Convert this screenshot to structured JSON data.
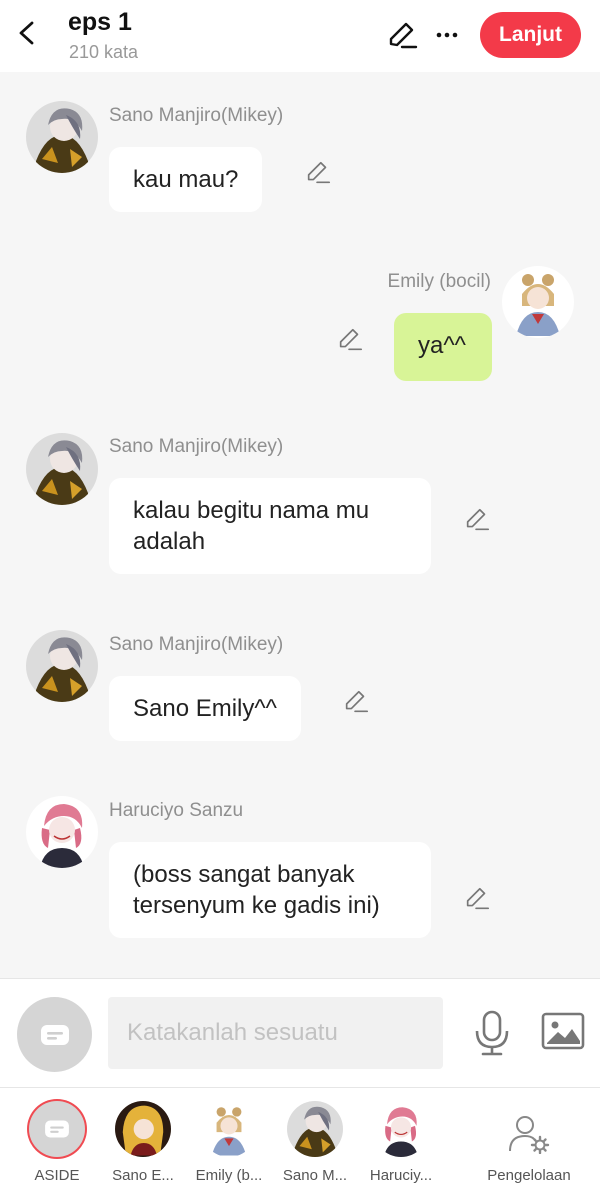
{
  "header": {
    "title": "eps 1",
    "word_count": "210 kata",
    "next_label": "Lanjut",
    "accent_color": "#f33a49"
  },
  "messages": [
    {
      "sender": "Sano Manjiro(Mikey)",
      "text": "kau mau?",
      "side": "left"
    },
    {
      "sender": "Emily (bocil)",
      "text": "ya^^",
      "side": "right"
    },
    {
      "sender": "Sano Manjiro(Mikey)",
      "text": "kalau begitu nama mu adalah",
      "side": "left"
    },
    {
      "sender": "Sano Manjiro(Mikey)",
      "text": "Sano Emily^^",
      "side": "left"
    },
    {
      "sender": "Haruciyo Sanzu",
      "text": "(boss sangat banyak tersenyum ke gadis ini)",
      "side": "left"
    }
  ],
  "composer": {
    "placeholder": "Katakanlah sesuatu",
    "value": ""
  },
  "bottom_tabs": [
    {
      "label": "ASIDE"
    },
    {
      "label": "Sano E..."
    },
    {
      "label": "Emily (b..."
    },
    {
      "label": "Sano M..."
    },
    {
      "label": "Haruciy..."
    },
    {
      "label": "Pengelolaan"
    }
  ],
  "colors": {
    "my_bubble": "#d8f497",
    "other_bubble": "#ffffff",
    "background": "#f6f6f6"
  }
}
